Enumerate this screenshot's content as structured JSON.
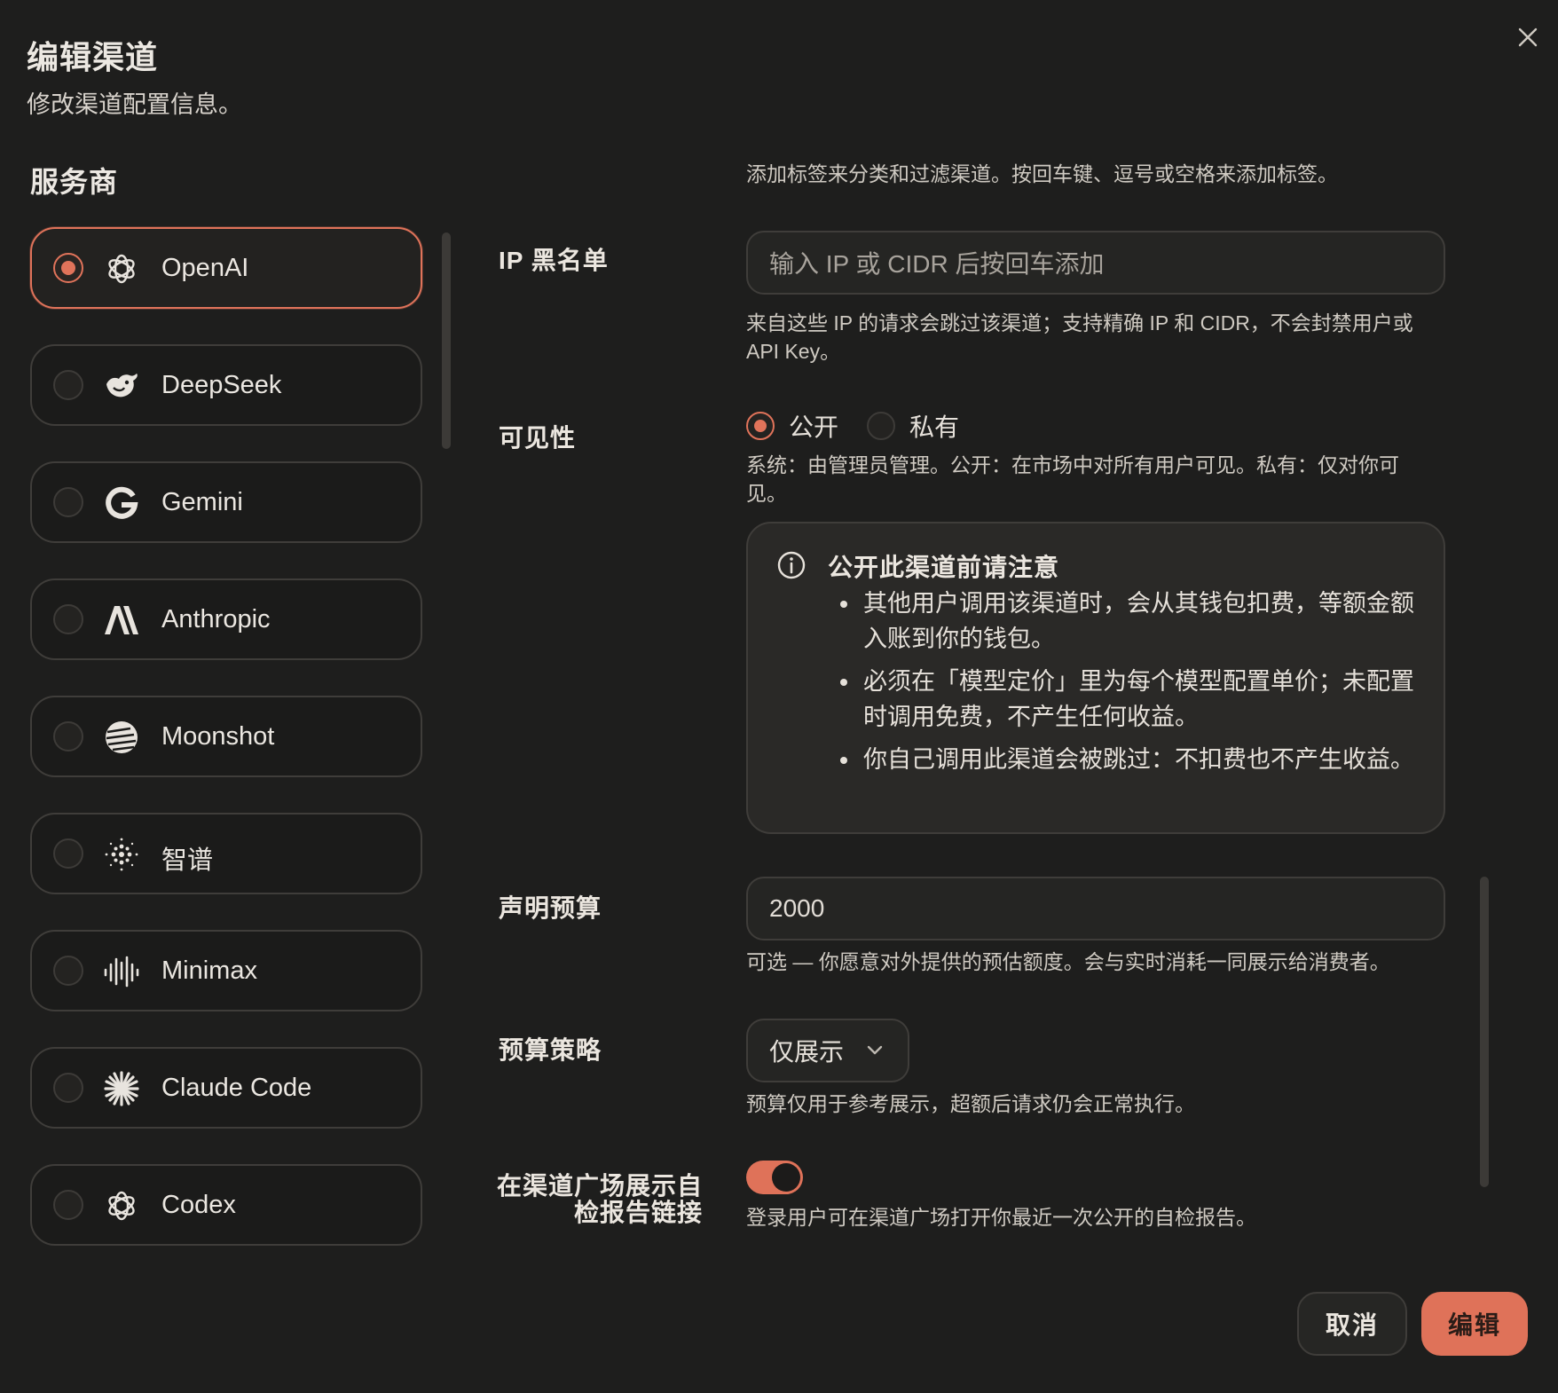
{
  "dialog": {
    "title": "编辑渠道",
    "subtitle": "修改渠道配置信息。"
  },
  "providers": {
    "heading": "服务商",
    "items": [
      {
        "label": "OpenAI",
        "icon": "openai-icon",
        "selected": true
      },
      {
        "label": "DeepSeek",
        "icon": "deepseek-icon",
        "selected": false
      },
      {
        "label": "Gemini",
        "icon": "gemini-icon",
        "selected": false
      },
      {
        "label": "Anthropic",
        "icon": "anthropic-icon",
        "selected": false
      },
      {
        "label": "Moonshot",
        "icon": "moonshot-icon",
        "selected": false
      },
      {
        "label": "智谱",
        "icon": "zhipu-icon",
        "selected": false
      },
      {
        "label": "Minimax",
        "icon": "minimax-icon",
        "selected": false
      },
      {
        "label": "Claude Code",
        "icon": "claude-code-icon",
        "selected": false
      },
      {
        "label": "Codex",
        "icon": "codex-icon",
        "selected": false
      }
    ]
  },
  "form": {
    "tags_help": "添加标签来分类和过滤渠道。按回车键、逗号或空格来添加标签。",
    "ip_blacklist": {
      "label": "IP 黑名单",
      "placeholder": "输入 IP 或 CIDR 后按回车添加",
      "help_line1": "来自这些 IP 的请求会跳过该渠道；支持精确 IP 和 CIDR，不会封禁用户或",
      "help_line2": "API Key。"
    },
    "visibility": {
      "label": "可见性",
      "options": [
        {
          "label": "公开",
          "selected": true
        },
        {
          "label": "私有",
          "selected": false
        }
      ],
      "help_line1": "系统：由管理员管理。公开：在市场中对所有用户可见。私有：仅对你可",
      "help_line2": "见。",
      "notice": {
        "icon": "info-icon",
        "title": "公开此渠道前请注意",
        "bullets": [
          "其他用户调用该渠道时，会从其钱包扣费，等额金额入账到你的钱包。",
          "必须在「模型定价」里为每个模型配置单价；未配置时调用免费，不产生任何收益。",
          "你自己调用此渠道会被跳过：不扣费也不产生收益。"
        ]
      }
    },
    "declared_budget": {
      "label": "声明预算",
      "value": "2000",
      "help": "可选 — 你愿意对外提供的预估额度。会与实时消耗一同展示给消费者。"
    },
    "budget_policy": {
      "label": "预算策略",
      "value": "仅展示",
      "help": "预算仅用于参考展示，超额后请求仍会正常执行。"
    },
    "show_report_link": {
      "label_line1": "在渠道广场展示自",
      "label_line2": "检报告链接",
      "enabled": true,
      "help": "登录用户可在渠道广场打开你最近一次公开的自检报告。"
    }
  },
  "footer": {
    "cancel_label": "取消",
    "submit_label": "编辑"
  },
  "colors": {
    "accent": "#df7259",
    "background": "#1e1e1d",
    "border": "#3f3d3a"
  }
}
